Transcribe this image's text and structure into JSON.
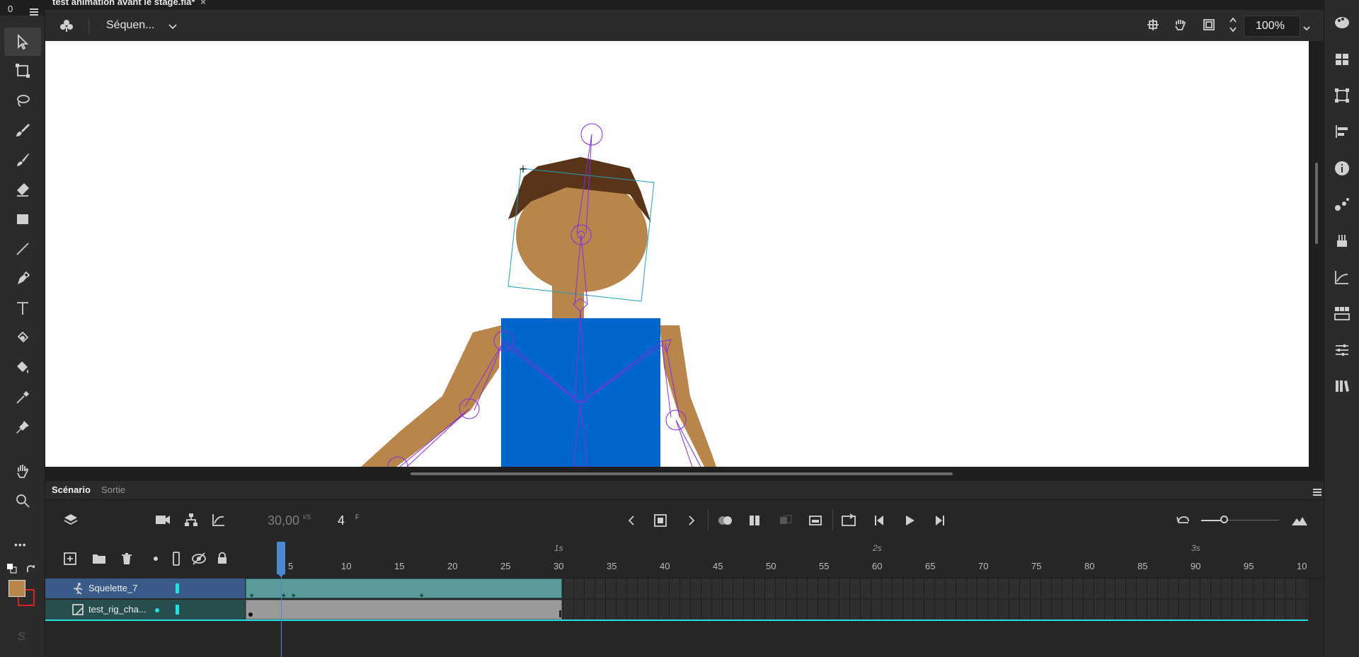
{
  "document": {
    "tab_title": "test animation avant le stage.fla*",
    "close_glyph": "×"
  },
  "workspace": {
    "corner_label": "0"
  },
  "topbar": {
    "scene_name": "Séquen...",
    "zoom": "100%"
  },
  "left_toolbar": {
    "tools": [
      "selection-tool",
      "free-transform-tool",
      "lasso-tool",
      "fluid-brush-tool",
      "classic-brush-tool",
      "eraser-tool",
      "rectangle-tool",
      "line-tool",
      "pen-tool",
      "text-tool",
      "paint-bucket-fill-tool",
      "bucket-tool",
      "eyedropper-tool",
      "pin-tool",
      "hand-tool",
      "zoom-tool"
    ],
    "more": "•••",
    "stroke_color": "#b8864b",
    "fill_color": "#e02020"
  },
  "timeline": {
    "tabs": [
      "Scénario",
      "Sortie"
    ],
    "fps": "30,00",
    "fps_unit": "I/S",
    "frame": "4",
    "frame_unit": "F",
    "ruler_numbers": [
      "5",
      "10",
      "15",
      "20",
      "25",
      "30",
      "35",
      "40",
      "45",
      "50",
      "55",
      "60",
      "65",
      "70",
      "75",
      "80",
      "85",
      "90",
      "95",
      "10"
    ],
    "second_labels": [
      "1s",
      "2s",
      "3s"
    ],
    "layers": [
      {
        "name": "Squelette_7",
        "color": "#20e0e0",
        "selected": true
      },
      {
        "name": "test_rig_cha...",
        "color": "#20e0e0",
        "selected": false
      }
    ],
    "playhead_frame": 4
  },
  "colors": {
    "skin": "#b8864b",
    "hair": "#5a3418",
    "body": "#0066cc",
    "bone": "#8a2be2",
    "frame_span": "#5a9a98"
  }
}
